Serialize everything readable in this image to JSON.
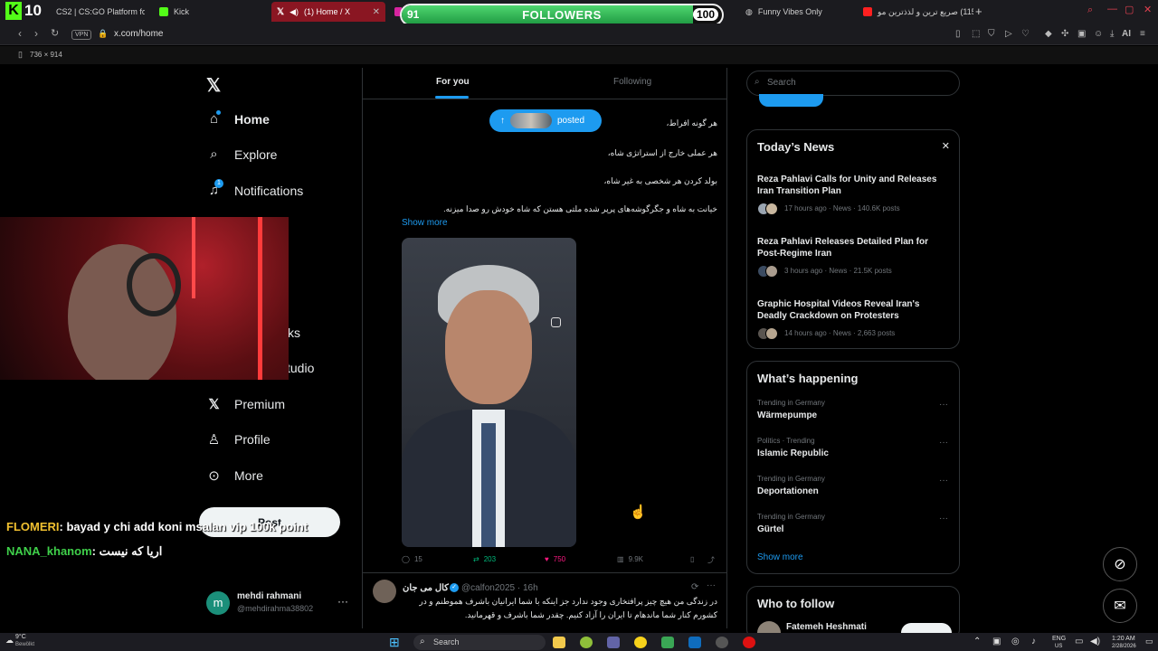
{
  "browser": {
    "tabs": [
      {
        "label": "CS2 | CS:GO Platform fo",
        "color": "#f0a02a",
        "active": false
      },
      {
        "label": "Kick",
        "color": "#53fc18",
        "active": false
      },
      {
        "label": "(1) Home / X",
        "color": "#ffffff",
        "active": true
      },
      {
        "label": "Funny Vibes Only",
        "color": "#cfcfcf",
        "active": false
      },
      {
        "label": "(115) صریع ترین و لذذترین مو",
        "color": "#ff2020",
        "active": false
      }
    ],
    "url": "x.com/home",
    "vpn": "VPN",
    "viewport_size": "736 × 914",
    "ai_label": "AI"
  },
  "stream_overlay": {
    "logo": "K",
    "logo_number": "10",
    "followers_label": "FOLLOWERS",
    "followers_current": "91",
    "followers_goal": "100",
    "followers_progress": 0.91,
    "chat": [
      {
        "name": "FLOMERI",
        "message": ": bayad y chi add koni msalan vip 100k point",
        "name_color": "#f0c030"
      },
      {
        "name": "NANA_khanom",
        "message": ": اریا که نیست",
        "name_color": "#3fd04a"
      }
    ]
  },
  "sidebar": {
    "items": [
      {
        "label": "Home",
        "icon": "home-icon"
      },
      {
        "label": "Explore",
        "icon": "search-icon"
      },
      {
        "label": "Notifications",
        "icon": "bell-icon",
        "badge": "1"
      },
      {
        "label": "ks",
        "icon": "bookmark-icon"
      },
      {
        "label": "tudio",
        "icon": "studio-icon"
      },
      {
        "label": "Premium",
        "icon": "x-premium-icon"
      },
      {
        "label": "Profile",
        "icon": "profile-icon"
      },
      {
        "label": "More",
        "icon": "more-circle-icon"
      }
    ],
    "post_label": "Post",
    "account": {
      "name": "mehdi rahmani",
      "handle": "@mehdirahma38802",
      "initial": "m"
    }
  },
  "feed": {
    "tabs": [
      {
        "label": "For you"
      },
      {
        "label": "Following"
      }
    ],
    "posted_label": "posted",
    "post_lines": [
      "هر گونه افراط،",
      "هر عملی خارج از استراتژی شاه،",
      "بولد کردن هر شخصی به غیر شاه،",
      "خیانت به شاه و جگرگوشه‌های پرپر شده ملتی هستن که شاه خودش رو صدا میزنه."
    ],
    "show_more": "Show more",
    "stats": {
      "replies": "15",
      "reposts": "203",
      "likes": "750",
      "views": "9.9K"
    },
    "next_post": {
      "name": "کال می جان",
      "handle": "@calfon2025 · 16h",
      "text_line1": "در زندگی من هیچ چیز پرافتخاری وجود ندارد جز اینکه با شما ایرانیان باشرف هموطنم و در",
      "text_line2": "کشورم کنار شما ماندهام تا ایران را آزاد کنیم.  چقدر شما باشرف و قهرمانید."
    }
  },
  "right": {
    "search_placeholder": "Search",
    "todays_news": {
      "title": "Today’s News",
      "items": [
        {
          "headline": "Reza Pahlavi Calls for Unity and Releases Iran Transition Plan",
          "meta": "17 hours ago · News · 140.6K posts"
        },
        {
          "headline": "Reza Pahlavi Releases Detailed Plan for Post-Regime Iran",
          "meta": "3 hours ago · News · 21.5K posts"
        },
        {
          "headline": "Graphic Hospital Videos Reveal Iran's Deadly Crackdown on Protesters",
          "meta": "14 hours ago · News · 2,663 posts"
        }
      ]
    },
    "whats_happening": {
      "title": "What’s happening",
      "items": [
        {
          "context": "Trending in Germany",
          "name": "Wärmepumpe"
        },
        {
          "context": "Politics · Trending",
          "name": "Islamic Republic"
        },
        {
          "context": "Trending in Germany",
          "name": "Deportationen"
        },
        {
          "context": "Trending in Germany",
          "name": "Gürtel"
        }
      ],
      "show_more": "Show more"
    },
    "who_to_follow": {
      "title": "Who to follow",
      "first_name": "Fatemeh Heshmati"
    }
  },
  "taskbar": {
    "weather_temp": "9°C",
    "weather_desc": "Bewölkt",
    "search_label": "Search",
    "lang_top": "ENG",
    "lang_bottom": "US",
    "time": "1:20 AM",
    "date": "2/28/2026"
  }
}
